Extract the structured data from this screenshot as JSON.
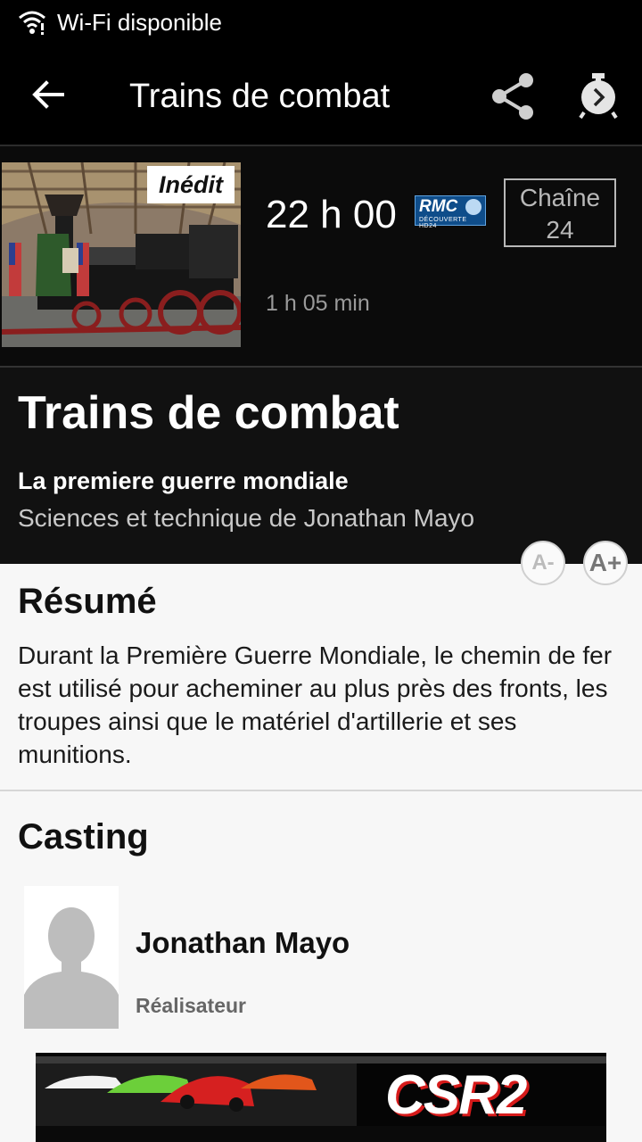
{
  "status_bar": {
    "text": "Wi-Fi disponible"
  },
  "app_bar": {
    "title": "Trains de combat"
  },
  "program": {
    "badge": "Inédit",
    "time": "22 h 00",
    "channel_logo_text": "RMC",
    "channel_logo_sub": "DÉCOUVERTE HD24",
    "channel_label": "Chaîne",
    "channel_number": "24",
    "duration": "1 h 05 min"
  },
  "details": {
    "title": "Trains de combat",
    "subtitle": "La premiere guerre mondiale",
    "genre_line": "Sciences et technique de Jonathan Mayo"
  },
  "font_controls": {
    "decrease": "A-",
    "increase": "A+"
  },
  "summary": {
    "heading": "Résumé",
    "text": "Durant la Première Guerre Mondiale, le chemin de fer est utilisé pour acheminer au plus près des fronts, les troupes ainsi que le matériel d'artillerie et ses munitions."
  },
  "casting": {
    "heading": "Casting",
    "people": [
      {
        "name": "Jonathan Mayo",
        "role": "Réalisateur"
      }
    ]
  },
  "ad": {
    "text": "CSR2"
  },
  "colors": {
    "accent": "#ffffff",
    "background": "#f7f7f7",
    "header": "#000000"
  }
}
